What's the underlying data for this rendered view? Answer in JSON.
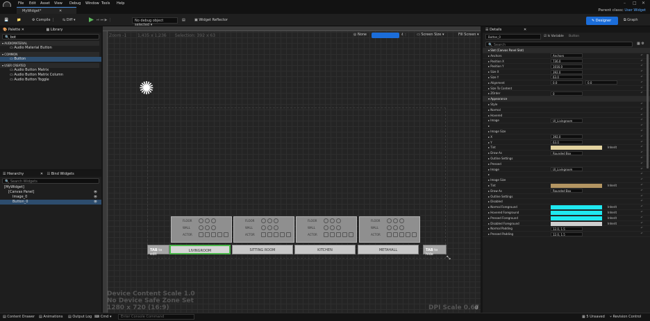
{
  "menu": [
    "File",
    "Edit",
    "Asset",
    "View",
    "Debug",
    "Window",
    "Tools",
    "Help"
  ],
  "doc_tab": "MyWidget*",
  "parent_class_label": "Parent class:",
  "parent_class": "User Widget",
  "toolbar": {
    "compile": "Compile",
    "diff": "Diff",
    "debug_select": "No debug object selected",
    "widget_reflector": "Widget Reflector",
    "designer": "Designer",
    "graph": "Graph"
  },
  "palette": {
    "tab": "Palette",
    "library_tab": "Library",
    "search_value": "bot",
    "categories": [
      {
        "name": "AUDIOMATERIAL",
        "items": [
          "Audio Material Button"
        ]
      },
      {
        "name": "COMMON",
        "items": [
          "Button"
        ]
      },
      {
        "name": "USER CREATED",
        "items": [
          "Audio Button Matrix",
          "Audio Button Matrix Column",
          "Audio Button Toggle"
        ]
      }
    ]
  },
  "hierarchy": {
    "tab": "Hierarchy",
    "bind_tab": "Bind Widgets",
    "search_placeholder": "Search Widgets",
    "items": [
      "[MyWidget]",
      "[Canvas Panel]",
      "Image_0",
      "Button_0"
    ]
  },
  "viewport": {
    "zoom": "Zoom -1",
    "dims": "1,435 x 1,236",
    "selection": "Selection: 392 x 63",
    "none_btn": "None",
    "screen_size": "Screen Size",
    "fill_screen": "Fill Screen",
    "device_scale": "Device Content Scale 1.0",
    "safe_zone": "No Device Safe Zone Set",
    "resolution": "1280 x 720 (16:9)",
    "dpi": "DPI Scale 0.67"
  },
  "cards": [
    {
      "label": "LIVINGROOM"
    },
    {
      "label": "SITTING ROOM"
    },
    {
      "label": "KITCHEN"
    },
    {
      "label": "METAHALL"
    }
  ],
  "card_rows": [
    "FLOOR",
    "WALL",
    "ACTOR"
  ],
  "tab_left": {
    "key": "TAB",
    "text": "to edit"
  },
  "tab_right": {
    "key": "TAB",
    "text": "to hide"
  },
  "details": {
    "tab": "Details",
    "name_value": "Button_0",
    "is_variable": "Is Variable",
    "type": "Button",
    "search_placeholder": "Search",
    "rows": [
      {
        "name": "Slot (Canvas Panel Slot)",
        "section": true
      },
      {
        "name": "Anchors",
        "value": "Anchors"
      },
      {
        "name": "Position X",
        "value": "736.0"
      },
      {
        "name": "Position Y",
        "value": "1016.0"
      },
      {
        "name": "Size X",
        "value": "392.0"
      },
      {
        "name": "Size Y",
        "value": "63.0"
      },
      {
        "name": "Alignment",
        "value": "0.0",
        "value2": "0.0"
      },
      {
        "name": "Size To Content",
        "value": ""
      },
      {
        "name": "ZOrder",
        "value": "0"
      },
      {
        "name": "Appearance",
        "section": true
      },
      {
        "name": "Style",
        "value": ""
      },
      {
        "name": "Normal",
        "value": ""
      },
      {
        "name": "Hovered",
        "value": ""
      },
      {
        "name": "Image",
        "value": "UI_Livingroom"
      },
      {
        "name": "",
        "value": ""
      },
      {
        "name": "Image Size",
        "value": ""
      },
      {
        "name": "X",
        "value": "392.0"
      },
      {
        "name": "Y",
        "value": "63.0"
      },
      {
        "name": "Tint",
        "value": "Inherit",
        "color": "#e3d3a0"
      },
      {
        "name": "Draw As",
        "value": "Rounded Box"
      },
      {
        "name": "Outline Settings",
        "value": ""
      },
      {
        "name": "Pressed",
        "value": ""
      },
      {
        "name": "Image",
        "value": "UI_Livingroom"
      },
      {
        "name": "",
        "value": ""
      },
      {
        "name": "Image Size",
        "value": ""
      },
      {
        "name": "Tint",
        "value": "Inherit",
        "color": "#b39562"
      },
      {
        "name": "Draw As",
        "value": "Rounded Box"
      },
      {
        "name": "Outline Settings",
        "value": ""
      },
      {
        "name": "Disabled",
        "value": ""
      },
      {
        "name": "Normal Foreground",
        "value": "Inherit",
        "color": "#1fe8f0"
      },
      {
        "name": "Hovered Foreground",
        "value": "Inherit",
        "color": "#1fe8f0"
      },
      {
        "name": "Pressed Foreground",
        "value": "Inherit",
        "color": "#1fe8f0"
      },
      {
        "name": "Disabled Foreground",
        "value": "Inherit",
        "color": "#cfcfcf"
      },
      {
        "name": "Normal Padding",
        "value": "12.0, 1.5"
      },
      {
        "name": "Pressed Padding",
        "value": "12.0, 1.5"
      }
    ]
  },
  "status": {
    "content_drawer": "Content Drawer",
    "animations": "Animations",
    "output_log": "Output Log",
    "cmd": "Cmd",
    "console_placeholder": "Enter Console Command",
    "unsaved": "5 Unsaved",
    "revision": "Revision Control"
  }
}
